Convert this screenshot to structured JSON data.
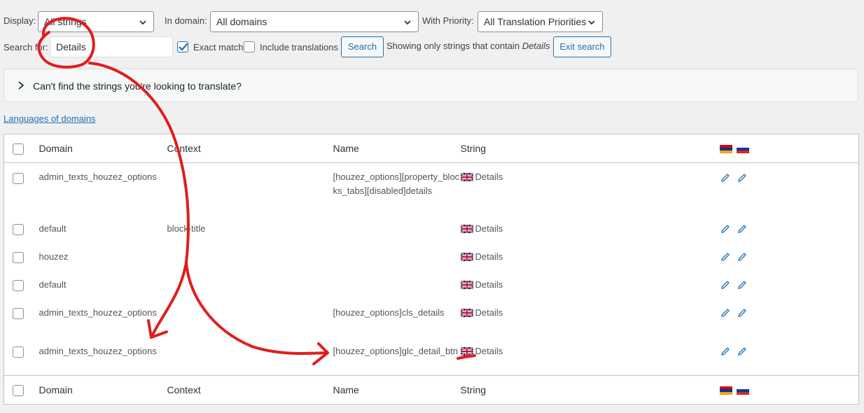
{
  "filters": {
    "display_label": "Display:",
    "display_value": "All strings",
    "domain_label": "In domain:",
    "domain_value": "All domains",
    "priority_label": "With Priority:",
    "priority_value": "All Translation Priorities"
  },
  "search": {
    "label": "Search for:",
    "value": "Details",
    "exact_match_label": "Exact match",
    "exact_match_checked": true,
    "include_translations_label": "Include translations",
    "include_translations_checked": false,
    "button_label": "Search",
    "info_prefix": "Showing only strings that contain",
    "info_term": "Details",
    "exit_button_label": "Exit search"
  },
  "help_panel": {
    "text": "Can't find the strings you're looking to translate?"
  },
  "languages_link": "Languages of domains",
  "table": {
    "columns": [
      "Domain",
      "Context",
      "Name",
      "String"
    ],
    "rows": [
      {
        "domain": "admin_texts_houzez_options",
        "context": "",
        "name": "[houzez_options][property_blocks_tabs][disabled]details",
        "string": "Details"
      },
      {
        "domain": "default",
        "context": "block-title",
        "name": "",
        "string": "Details"
      },
      {
        "domain": "houzez",
        "context": "",
        "name": "",
        "string": "Details"
      },
      {
        "domain": "default",
        "context": "",
        "name": "",
        "string": "Details"
      },
      {
        "domain": "admin_texts_houzez_options",
        "context": "",
        "name": "[houzez_options]cls_details",
        "string": "Details"
      },
      {
        "domain": "admin_texts_houzez_options",
        "context": "",
        "name": "[houzez_options]glc_detail_btn",
        "string": "Details"
      }
    ]
  },
  "colors": {
    "accent": "#2271b1",
    "annotation": "#e11d1d",
    "background": "#f0f0f1"
  }
}
